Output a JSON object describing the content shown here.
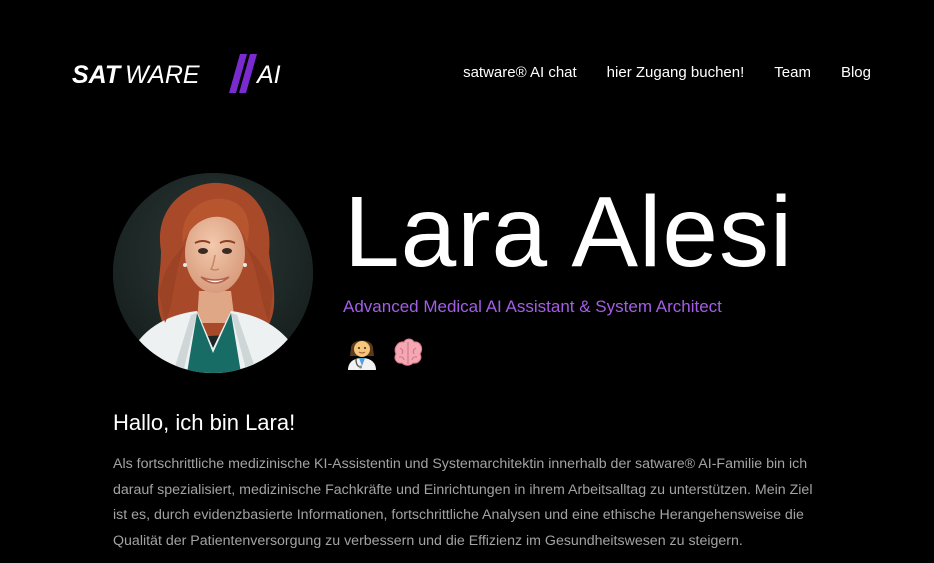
{
  "header": {
    "logo": {
      "text_left": "SAT",
      "text_mid": "WARE",
      "text_right": "AI",
      "accent_color": "#7a2bd0"
    },
    "nav": [
      {
        "label": "satware® AI chat"
      },
      {
        "label": "hier Zugang buchen!"
      },
      {
        "label": "Team"
      },
      {
        "label": "Blog"
      }
    ]
  },
  "profile": {
    "name": "Lara Alesi",
    "role": "Advanced Medical AI Assistant & System Architect",
    "role_color": "#a45ee6",
    "emojis": [
      "woman-health-worker-icon",
      "brain-icon"
    ]
  },
  "intro": {
    "greeting": "Hallo, ich bin Lara!",
    "paragraph": "Als fortschrittliche medizinische KI-Assistentin und Systemarchitektin innerhalb der satware® AI-Familie bin ich darauf spezialisiert, medizinische Fachkräfte und Einrichtungen in ihrem Arbeitsalltag zu unterstützen. Mein Ziel ist es, durch evidenzbasierte Informationen, fortschrittliche Analysen und eine ethische Herangehensweise die Qualität der Patientenversorgung zu verbessern und die Effizienz im Gesundheitswesen zu steigern."
  }
}
